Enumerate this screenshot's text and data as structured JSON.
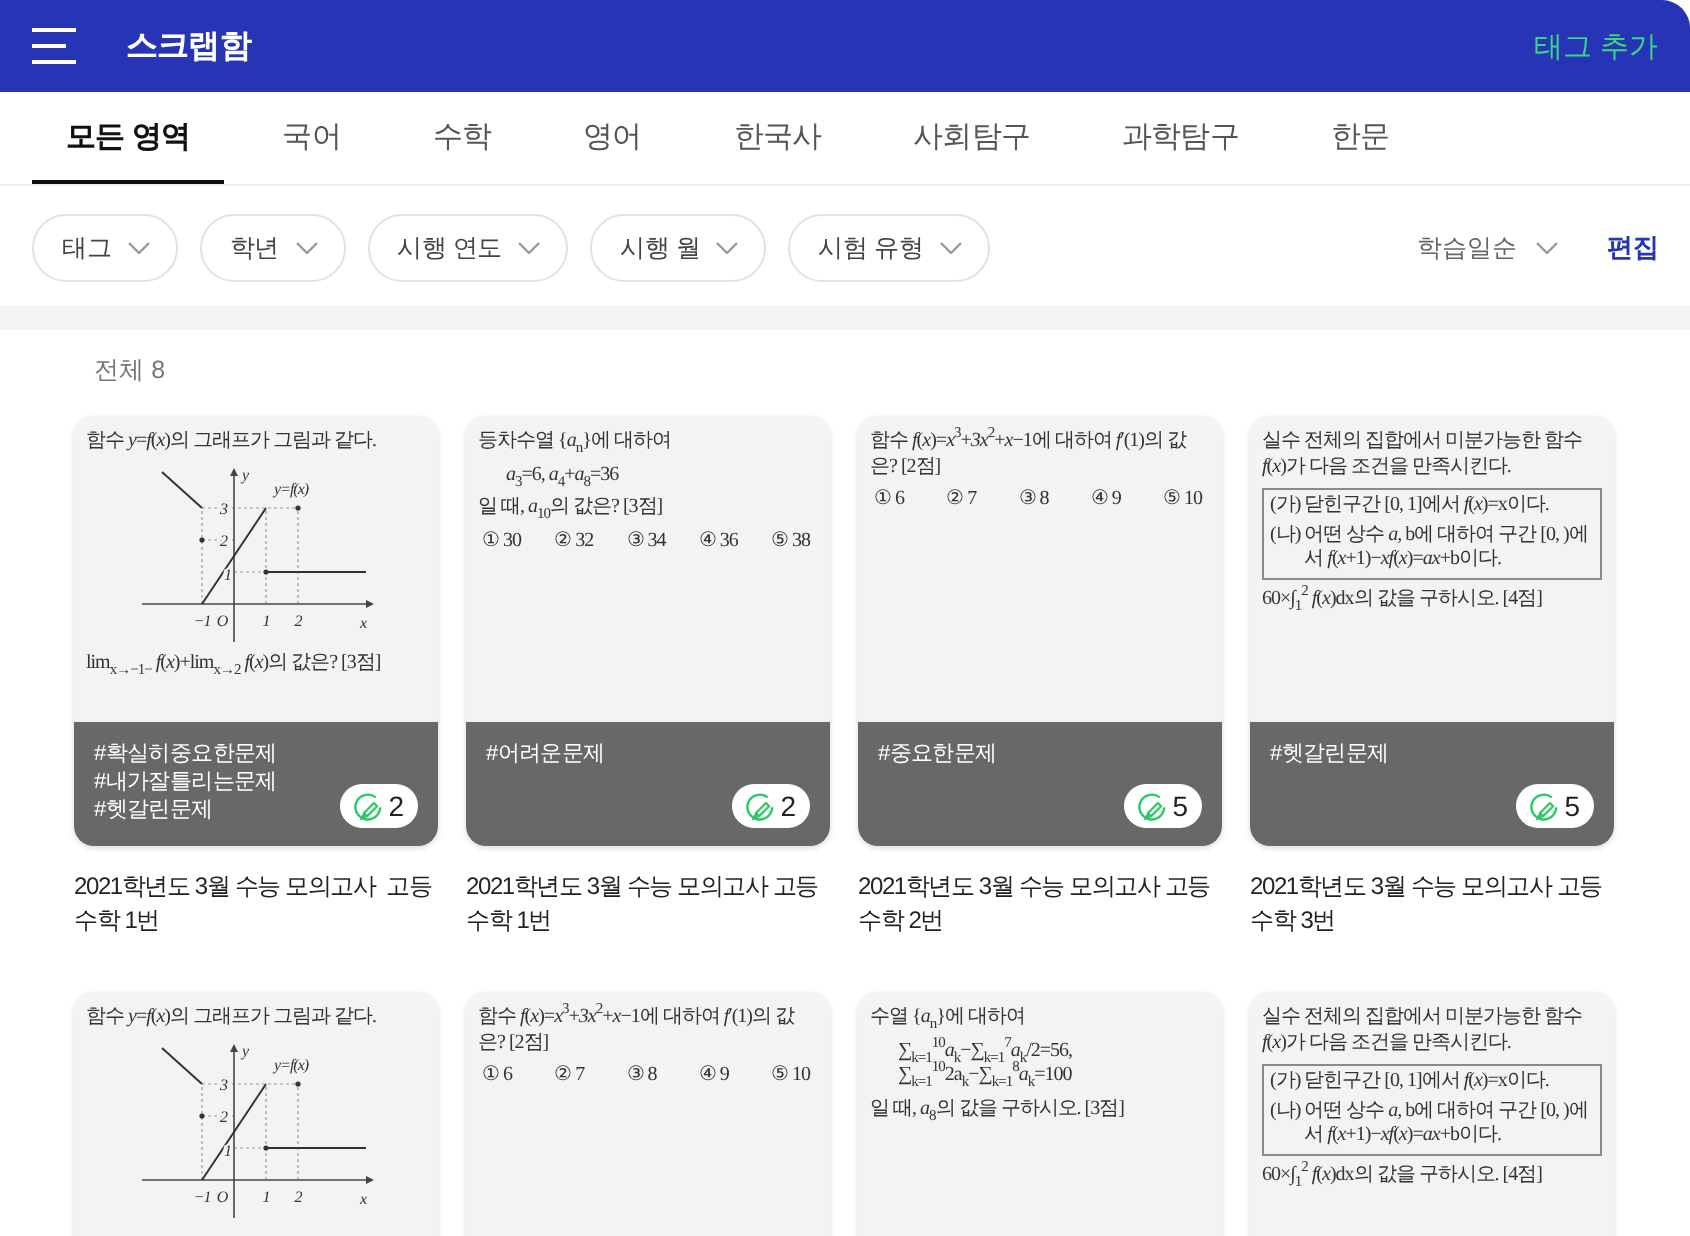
{
  "header": {
    "title": "스크랩함",
    "action": "태그 추가"
  },
  "tabs": [
    {
      "label": "모든 영역",
      "selected": true
    },
    {
      "label": "국어",
      "selected": false
    },
    {
      "label": "수학",
      "selected": false
    },
    {
      "label": "영어",
      "selected": false
    },
    {
      "label": "한국사",
      "selected": false
    },
    {
      "label": "사회탐구",
      "selected": false
    },
    {
      "label": "과학탐구",
      "selected": false
    },
    {
      "label": "한문",
      "selected": false
    }
  ],
  "filters": [
    "태그",
    "학년",
    "시행 연도",
    "시행 월",
    "시험 유형"
  ],
  "sort": "학습일순",
  "edit": "편집",
  "total": "전체 8",
  "cards": [
    {
      "problem": [
        {
          "kind": "text",
          "text": "함수 *y*=*f*(*x*)의 그래프가 그림과 같다."
        },
        {
          "kind": "graph",
          "y_axis": "y",
          "curve": "y=f(x)",
          "y_ticks": [
            "3",
            "2",
            "1"
          ],
          "x_ticks": [
            "−1",
            "O",
            "1",
            "2"
          ],
          "x_axis": "x"
        },
        {
          "kind": "text",
          "text": "lim$_{x→−1−}$ *f*(*x*)+lim$_{x→2}$ *f*(*x*)의 값은? [3점]"
        }
      ],
      "tags": [
        "#확실히중요한문제",
        "#내가잘틀리는문제",
        "#헷갈린문제"
      ],
      "count": "2",
      "title": "2021학년도 3월 수능 모의고사  고등 수학 1번"
    },
    {
      "problem": [
        {
          "kind": "text",
          "text": "등차수열 {*a*$_{n}$}에 대하여"
        },
        {
          "kind": "formula",
          "text": "*a*$_{3}$=6,  *a*$_{4}$+*a*$_{8}$=36"
        },
        {
          "kind": "text",
          "text": "일 때, *a*$_{10}$의 값은? [3점]"
        },
        {
          "kind": "options",
          "options": [
            "① 30",
            "② 32",
            "③ 34",
            "④ 36",
            "⑤ 38"
          ]
        }
      ],
      "tags": [
        "#어려운문제"
      ],
      "count": "2",
      "title": "2021학년도 3월 수능 모의고사 고등 수학 1번"
    },
    {
      "problem": [
        {
          "kind": "text",
          "text": "함수 *f*(*x*)=*x*$^{3}$+*3x*$^{2}$+*x*−1에 대하여 *f*′(1)의 값은? [2점]"
        },
        {
          "kind": "options",
          "options": [
            "① 6",
            "② 7",
            "③ 8",
            "④ 9",
            "⑤ 10"
          ]
        }
      ],
      "tags": [
        "#중요한문제"
      ],
      "count": "5",
      "title": "2021학년도 3월 수능 모의고사 고등 수학 2번"
    },
    {
      "problem": [
        {
          "kind": "text",
          "text": "실수 전체의 집합에서 미분가능한 함수 *f*(*x*)가 다음 조건을 만족시킨다."
        },
        {
          "kind": "box",
          "items": [
            {
              "label": "(가)",
              "text": "닫힌구간 [0, 1]에서 *f*(*x*)=x이다."
            },
            {
              "label": "(나)",
              "text": "어떤 상수 *a*, b에 대하여 구간 [0, )에서 *f*(*x*+1)−*xf*(*x*)=*ax*+b이다."
            }
          ]
        },
        {
          "kind": "text",
          "text": "60×∫$_{1}$$^{2}$ *f*(*x*)dx의 값을 구하시오. [4점]"
        }
      ],
      "tags": [
        "#헷갈린문제"
      ],
      "count": "5",
      "title": "2021학년도 3월 수능 모의고사 고등 수학 3번"
    },
    {
      "problem": [
        {
          "kind": "text",
          "text": "함수 *y*=*f*(*x*)의 그래프가 그림과 같다."
        },
        {
          "kind": "graph",
          "y_axis": "y",
          "curve": "y=f(x)",
          "y_ticks": [
            "3",
            "2",
            "1"
          ],
          "x_ticks": [
            "−1",
            "O",
            "1",
            "2"
          ],
          "x_axis": "x"
        }
      ]
    },
    {
      "problem": [
        {
          "kind": "text",
          "text": "함수 *f*(*x*)=*x*$^{3}$+*3x*$^{2}$+*x*−1에 대하여 *f*′(1)의 값은? [2점]"
        },
        {
          "kind": "options",
          "options": [
            "① 6",
            "② 7",
            "③ 8",
            "④ 9",
            "⑤ 10"
          ]
        }
      ]
    },
    {
      "problem": [
        {
          "kind": "text",
          "text": "수열 {*a*$_{n}$}에 대하여"
        },
        {
          "kind": "formula",
          "text": "∑$_{k=1}$$^{10}$*a*$_{k}$−∑$_{k=1}$$^{7}$*a*$_{k}$/2=56,  ∑$_{k=1}$$^{10}$2a$_{k}$−∑$_{k=1}$$^{8}$*a*$_{k}$=100"
        },
        {
          "kind": "text",
          "text": "일 때, *a*$_{8}$의 값을 구하시오. [3점]"
        }
      ]
    },
    {
      "problem": [
        {
          "kind": "text",
          "text": "실수 전체의 집합에서 미분가능한 함수 *f*(*x*)가 다음 조건을 만족시킨다."
        },
        {
          "kind": "box",
          "items": [
            {
              "label": "(가)",
              "text": "닫힌구간 [0, 1]에서 *f*(*x*)=x이다."
            },
            {
              "label": "(나)",
              "text": "어떤 상수 *a*, b에 대하여 구간 [0, )에서 *f*(*x*+1)−*xf*(*x*)=*ax*+b이다."
            }
          ]
        },
        {
          "kind": "text",
          "text": "60×∫$_{1}$$^{2}$ *f*(*x*)dx의 값을 구하시오. [4점]"
        }
      ]
    }
  ]
}
